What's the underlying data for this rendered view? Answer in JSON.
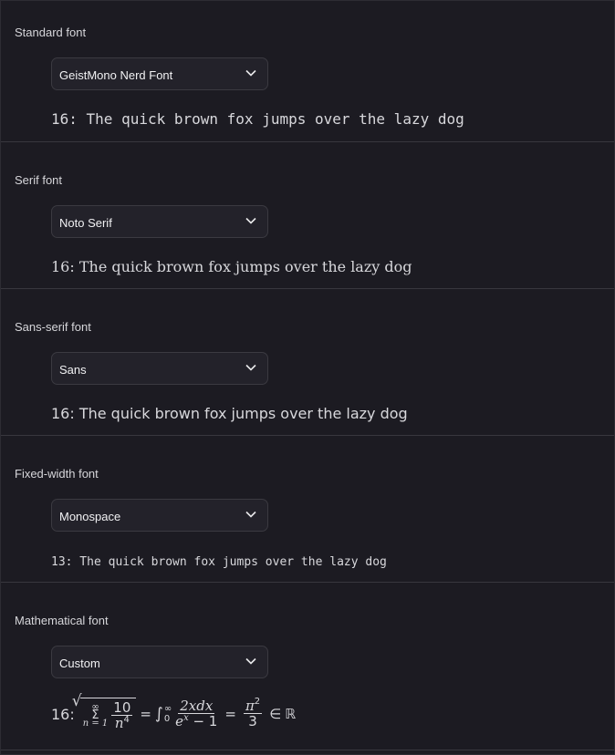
{
  "sections": [
    {
      "label": "Standard font",
      "value": "GeistMono Nerd Font",
      "sample": "16: The quick brown fox jumps over the lazy dog"
    },
    {
      "label": "Serif font",
      "value": "Noto Serif",
      "sample": "16: The quick brown fox jumps over the lazy dog"
    },
    {
      "label": "Sans-serif font",
      "value": "Sans",
      "sample": "16: The quick brown fox jumps over the lazy dog"
    },
    {
      "label": "Fixed-width font",
      "value": "Monospace",
      "sample": "13: The quick brown fox jumps over the lazy dog"
    },
    {
      "label": "Mathematical font",
      "value": "Custom",
      "sample_prefix": "16:"
    }
  ],
  "math": {
    "sum_upper": "∞",
    "sum_lower": "n = 1",
    "frac1_num": "10",
    "frac1_den": "n",
    "frac1_den_exp": "4",
    "eq": "=",
    "int_upper": "∞",
    "int_lower": "0",
    "frac2_num": "2xdx",
    "frac2_den": "e",
    "frac2_den_exp": "x",
    "frac2_den_tail": " − 1",
    "frac3_num": "π",
    "frac3_num_exp": "2",
    "frac3_den": "3",
    "in": "∈",
    "reals": "ℝ"
  },
  "colors": {
    "background": "#1c1b22",
    "select_bg": "#23222a",
    "border": "#38373e"
  }
}
